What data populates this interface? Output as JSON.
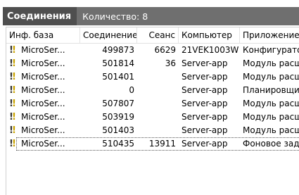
{
  "panel": {
    "title": "Соединения",
    "count_label": "Количество:",
    "count_value": "8"
  },
  "columns": [
    "Инф. база",
    "Соединение",
    "Сеанс",
    "Компьютер",
    "Приложение"
  ],
  "rows": [
    {
      "infobase": "MicroSer...",
      "connection": "499873",
      "session": "6629",
      "computer": "21VEK1003W",
      "application": "Конфигуратор"
    },
    {
      "infobase": "MicroSer...",
      "connection": "501814",
      "session": "36",
      "computer": "Server-app",
      "application": "Модуль расш"
    },
    {
      "infobase": "MicroSer...",
      "connection": "501401",
      "session": "",
      "computer": "Server-app",
      "application": "Модуль расш"
    },
    {
      "infobase": "MicroSer...",
      "connection": "0",
      "session": "",
      "computer": "Server-app",
      "application": "Планировщи"
    },
    {
      "infobase": "MicroSer...",
      "connection": "507807",
      "session": "",
      "computer": "Server-app",
      "application": "Модуль расш"
    },
    {
      "infobase": "MicroSer...",
      "connection": "503919",
      "session": "",
      "computer": "Server-app",
      "application": "Модуль расш"
    },
    {
      "infobase": "MicroSer...",
      "connection": "501403",
      "session": "",
      "computer": "Server-app",
      "application": "Модуль расш"
    },
    {
      "infobase": "MicroSer...",
      "connection": "510435",
      "session": "13911",
      "computer": "Server-app",
      "application": "Фоновое зада"
    }
  ],
  "selected_row": 7,
  "row_icon": "connection-warning-icon"
}
